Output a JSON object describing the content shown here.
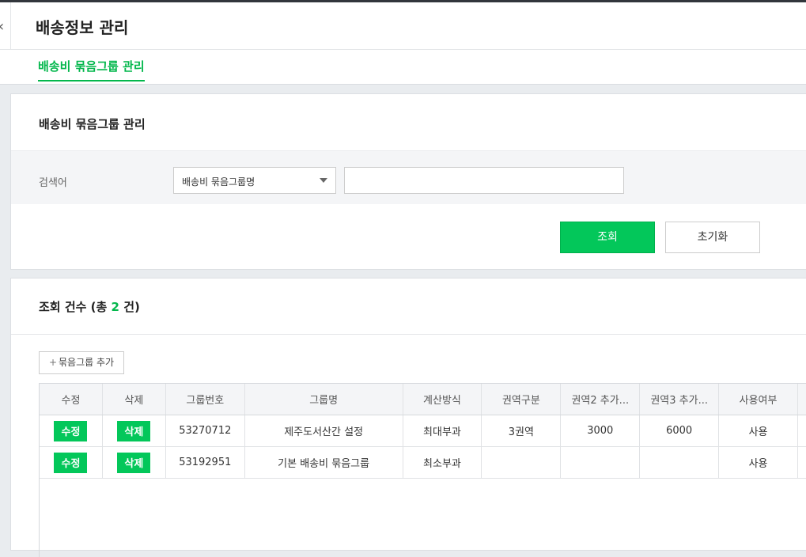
{
  "header": {
    "title": "배송정보 관리",
    "back_icon": "‹"
  },
  "tabs": [
    {
      "label": "배송비 묶음그룹 관리",
      "active": true
    }
  ],
  "search_panel": {
    "title": "배송비 묶음그룹 관리",
    "label": "검색어",
    "select_value": "배송비 묶음그룹명",
    "input_value": "",
    "search_button": "조회",
    "reset_button": "초기화"
  },
  "results": {
    "title_prefix": "조회 건수 (총 ",
    "count": "2",
    "title_suffix": " 건)",
    "add_button": "묶음그룹 추가",
    "columns": [
      "수정",
      "삭제",
      "그룹번호",
      "그룹명",
      "계산방식",
      "권역구분",
      "권역2 추가...",
      "권역3 추가...",
      "사용여부"
    ],
    "rows": [
      {
        "edit": "수정",
        "delete": "삭제",
        "group_no": "53270712",
        "group_name": "제주도서산간 설정",
        "calc": "최대부과",
        "region": "3권역",
        "region2": "3000",
        "region3": "6000",
        "use": "사용"
      },
      {
        "edit": "수정",
        "delete": "삭제",
        "group_no": "53192951",
        "group_name": "기본 배송비 묶음그룹",
        "calc": "최소부과",
        "region": "",
        "region2": "",
        "region3": "",
        "use": "사용"
      }
    ]
  },
  "colors": {
    "accent": "#03c75a",
    "accent_text": "#03b74c"
  }
}
